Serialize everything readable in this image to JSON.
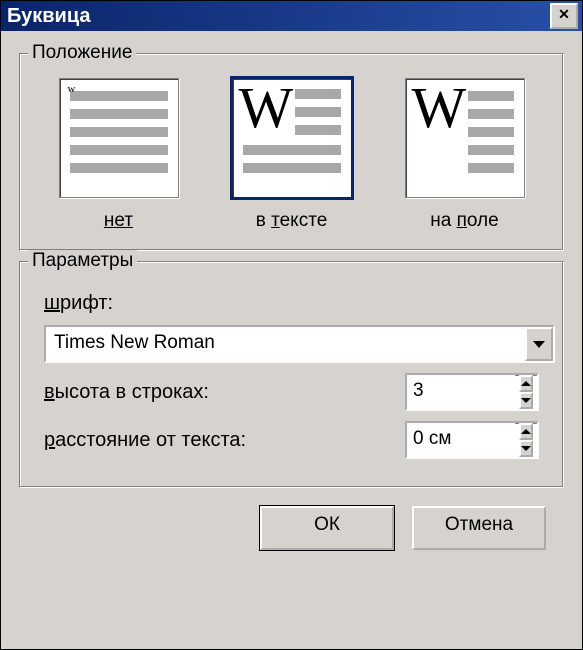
{
  "window": {
    "title": "Буквица"
  },
  "position": {
    "group_label": "Положение",
    "options": {
      "none": "нет",
      "intext": "в тексте",
      "margin": "на поле"
    },
    "selected": "intext"
  },
  "params": {
    "group_label": "Параметры",
    "font_label": "шрифт:",
    "font_value": "Times New Roman",
    "lines_label": "высота в строках:",
    "lines_value": "3",
    "distance_label": "расстояние от текста:",
    "distance_value": "0 см"
  },
  "buttons": {
    "ok": "ОК",
    "cancel": "Отмена"
  }
}
